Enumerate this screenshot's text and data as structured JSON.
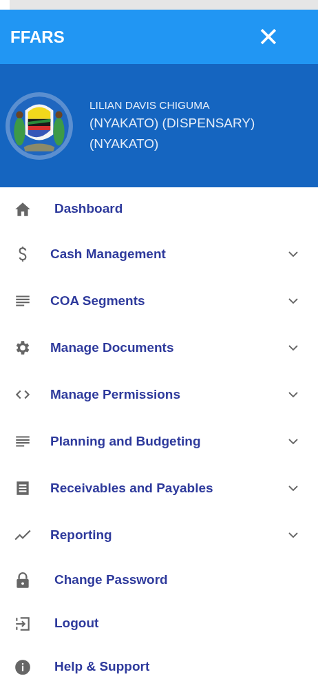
{
  "header": {
    "title": "FFARS",
    "close": "✕"
  },
  "profile": {
    "name": "LILIAN DAVIS CHIGUMA",
    "facility": "(NYAKATO) (DISPENSARY)\n(NYAKATO)"
  },
  "menu": [
    {
      "label": "Dashboard",
      "kind": "link"
    },
    {
      "label": "Cash Management",
      "kind": "group",
      "expanded": false
    },
    {
      "label": "COA Segments",
      "kind": "group",
      "expanded": false
    },
    {
      "label": "Manage Documents",
      "kind": "group",
      "expanded": false
    },
    {
      "label": "Manage Permissions",
      "kind": "group",
      "expanded": false
    },
    {
      "label": "Planning and Budgeting",
      "kind": "group",
      "expanded": false
    },
    {
      "label": "Receivables and Payables",
      "kind": "group",
      "expanded": false
    },
    {
      "label": "Reporting",
      "kind": "group",
      "expanded": false
    },
    {
      "label": "Change Password",
      "kind": "link"
    },
    {
      "label": "Logout",
      "kind": "link"
    },
    {
      "label": "Help & Support",
      "kind": "link"
    }
  ]
}
